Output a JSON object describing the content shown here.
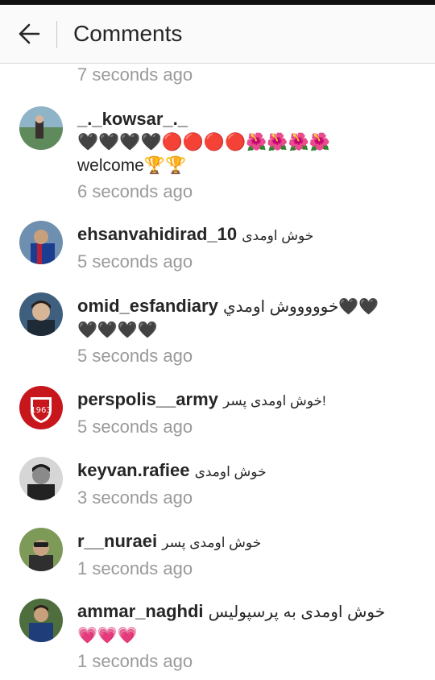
{
  "header": {
    "title": "Comments",
    "back_icon": "arrow-left-icon"
  },
  "previous_time": "7 seconds ago",
  "comments": [
    {
      "username": "_._kowsar_._",
      "text": "🖤🖤🖤🖤🔴🔴🔴🔴🌺🌺🌺🌺welcome🏆🏆",
      "time": "6 seconds ago"
    },
    {
      "username": "ehsanvahidirad_10",
      "text": "خوش اومدی",
      "time": "5 seconds ago"
    },
    {
      "username": "omid_esfandiary",
      "text": "خوووووش اومدي🖤🖤🖤🖤🖤🖤",
      "time": "5 seconds ago"
    },
    {
      "username": "perspolis__army",
      "text": "خوش اومدی پسر!",
      "time": "5 seconds ago"
    },
    {
      "username": "keyvan.rafiee",
      "text": "خوش اومدی",
      "time": "3 seconds ago"
    },
    {
      "username": "r__nuraei",
      "text": "خوش اومدی پسر",
      "time": "1 seconds ago"
    },
    {
      "username": "ammar_naghdi",
      "text": "خوش اومدی به پرسپولیس💗💗💗",
      "time": "1 seconds ago"
    }
  ]
}
